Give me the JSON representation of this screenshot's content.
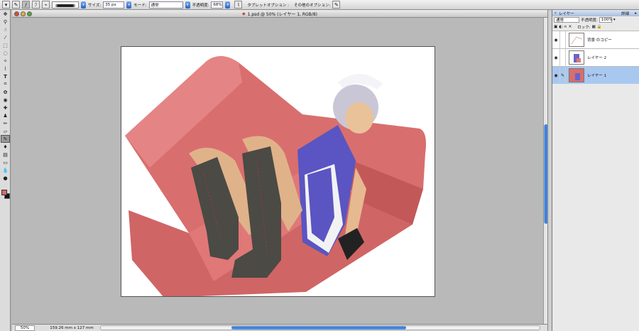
{
  "options_bar": {
    "size_label": "サイズ:",
    "size_value": "35 px",
    "mode_label": "モード:",
    "mode_value": "通常",
    "opacity_label": "不透明度:",
    "opacity_value": "68%",
    "tablet_label": "タブレットオプション :",
    "other_label": "その他のオプション:"
  },
  "document": {
    "title": "1.psd @ 50% (レイヤー 1, RGB/8)",
    "zoom": "50%",
    "doc_size": "159.26 mm x 127 mm"
  },
  "layers_panel": {
    "tab": "レイヤー",
    "more_label": "詳細",
    "blend_mode": "通常",
    "opacity_label": "不透明度:",
    "opacity_value": "100%",
    "lock_label": "ロック:",
    "layers": [
      {
        "name": "背景 のコピー"
      },
      {
        "name": "レイヤー 2"
      },
      {
        "name": "レイヤー 1"
      }
    ]
  },
  "colors": {
    "foreground": "#d46a6a",
    "background": "#111111",
    "accent": "#2e6fd2"
  },
  "icons": [
    "brush-icon",
    "move-icon",
    "zoom-icon",
    "eye-icon",
    "airbrush-icon"
  ]
}
